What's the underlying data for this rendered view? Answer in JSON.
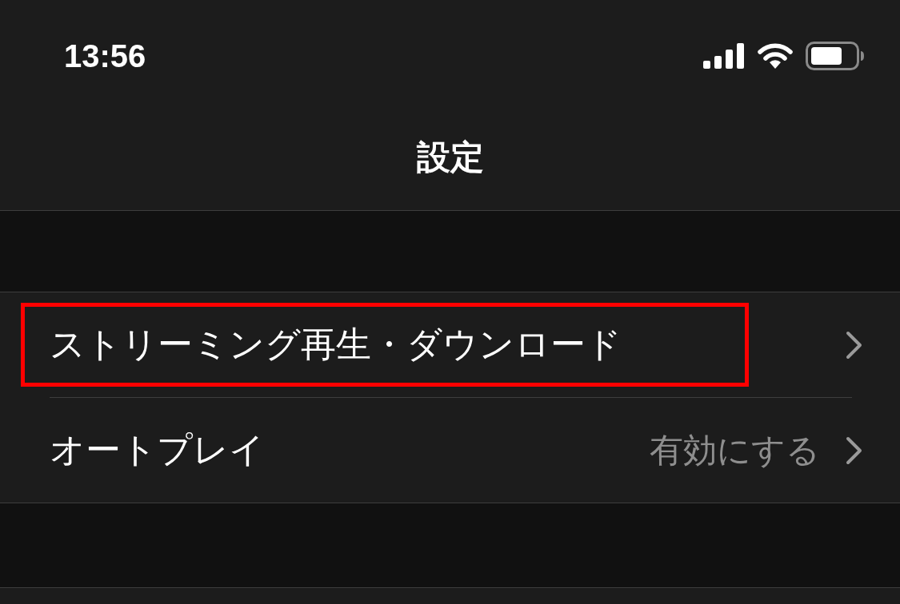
{
  "status_bar": {
    "time": "13:56"
  },
  "nav_bar": {
    "title": "設定"
  },
  "rows": [
    {
      "label": "ストリーミング再生・ダウンロード",
      "highlighted": true
    },
    {
      "label": "オートプレイ",
      "value": "有効にする",
      "highlighted": false
    }
  ]
}
